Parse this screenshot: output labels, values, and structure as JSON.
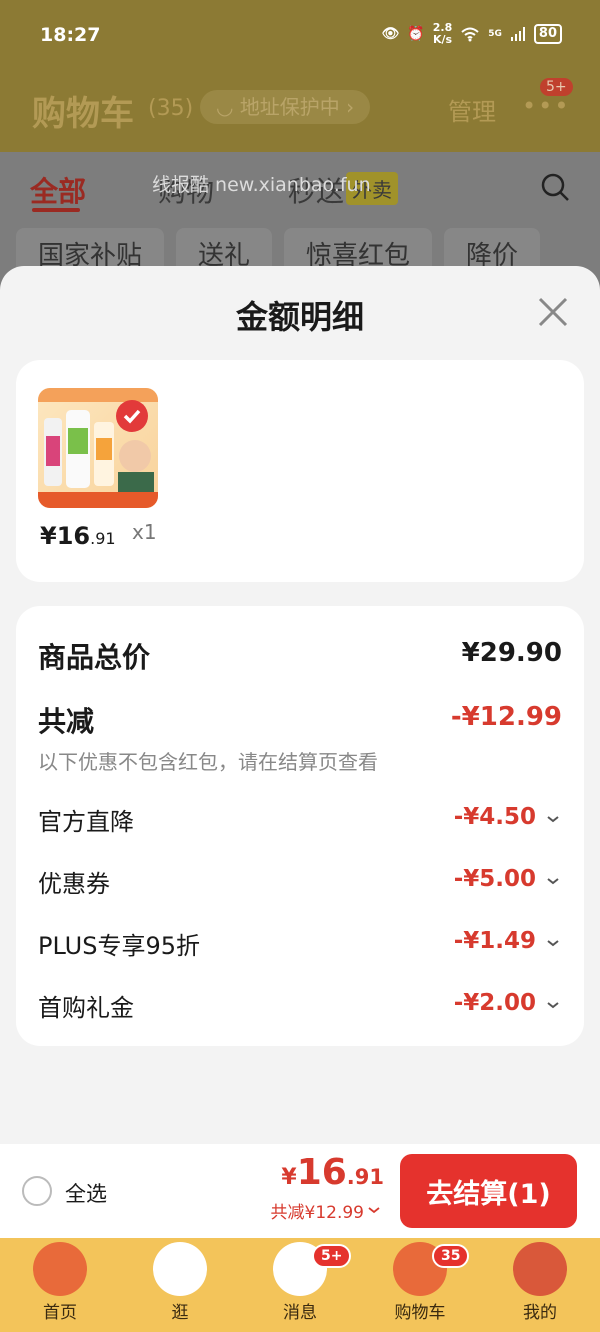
{
  "status_bar": {
    "time": "18:27",
    "net_speed_top": "2.8",
    "net_speed_bottom": "K/s",
    "signal": "5G",
    "battery": "80"
  },
  "header": {
    "title": "购物车",
    "count": "(35)",
    "address_label": "地址保护中",
    "manage_label": "管理",
    "more_badge": "5+"
  },
  "tabs": [
    {
      "label": "全部",
      "active": true
    },
    {
      "label": "购物"
    },
    {
      "label": "秒送"
    }
  ],
  "waimai_tag": "外卖",
  "watermark": "线报酷 new.xianbao.fun",
  "chips": [
    "国家补贴",
    "送礼",
    "惊喜红包",
    "降价"
  ],
  "sheet": {
    "title": "金额明细",
    "product": {
      "price_int": "¥16",
      "price_dec": ".91",
      "qty": "x1"
    },
    "summary": {
      "total_label": "商品总价",
      "total_value": "¥29.90",
      "discount_label": "共减",
      "discount_value": "-¥12.99",
      "note": "以下优惠不包含红包，请在结算页查看",
      "items": [
        {
          "label": "官方直降",
          "value": "-¥4.50"
        },
        {
          "label": "优惠券",
          "value": "-¥5.00"
        },
        {
          "label": "PLUS专享95折",
          "value": "-¥1.49"
        },
        {
          "label": "首购礼金",
          "value": "-¥2.00"
        }
      ]
    }
  },
  "checkout": {
    "select_all_label": "全选",
    "price_currency": "¥",
    "price_int": "16",
    "price_dec": ".91",
    "discount_text": "共减¥12.99",
    "button_label": "去结算(1)"
  },
  "tabbar": [
    {
      "label": "首页",
      "color": "#e86a3a"
    },
    {
      "label": "逛",
      "color": "#ffffff",
      "badge": ""
    },
    {
      "label": "消息",
      "color": "#ffffff",
      "badge": "5+"
    },
    {
      "label": "购物车",
      "color": "#e86a3a",
      "badge": "35"
    },
    {
      "label": "我的",
      "color": "#d9583a"
    }
  ],
  "colors": {
    "accent_red": "#e5322d",
    "price_red": "#d73a2e",
    "tabbar_yellow": "#f3c45a"
  }
}
